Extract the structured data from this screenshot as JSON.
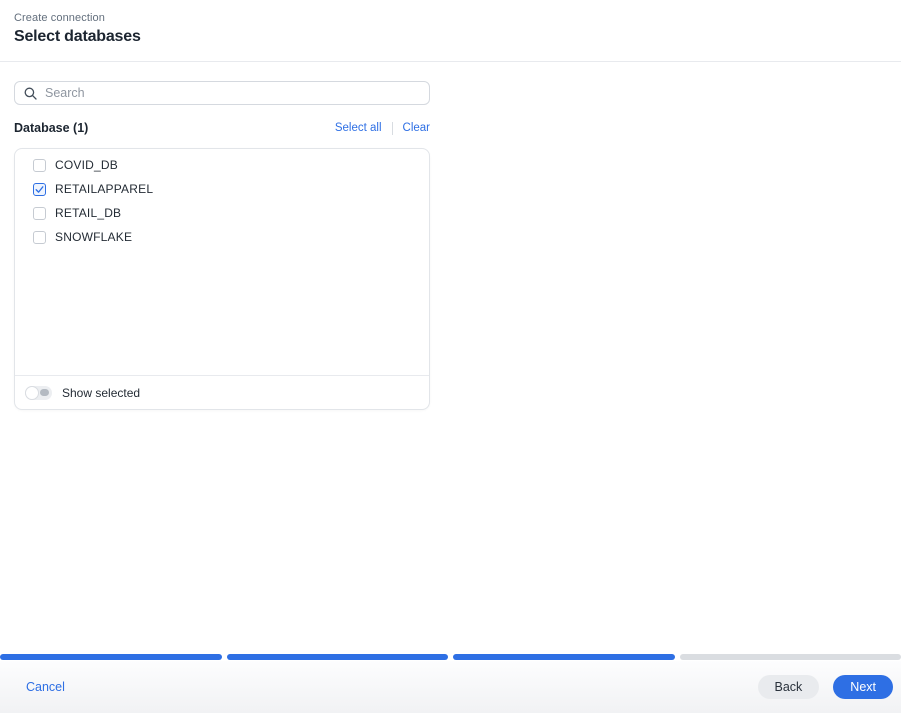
{
  "header": {
    "breadcrumb": "Create connection",
    "title": "Select databases"
  },
  "search": {
    "placeholder": "Search",
    "value": ""
  },
  "list_header": {
    "label": "Database (1)",
    "select_all_label": "Select all",
    "clear_label": "Clear"
  },
  "databases": [
    {
      "name": "COVID_DB",
      "checked": false
    },
    {
      "name": "RETAILAPPAREL",
      "checked": true
    },
    {
      "name": "RETAIL_DB",
      "checked": false
    },
    {
      "name": "SNOWFLAKE",
      "checked": false
    }
  ],
  "show_selected": {
    "label": "Show selected",
    "enabled": false
  },
  "progress": {
    "total_steps": 4,
    "completed_steps": 3
  },
  "footer": {
    "cancel_label": "Cancel",
    "back_label": "Back",
    "next_label": "Next"
  },
  "icons": {
    "search": "magnifying-glass",
    "checkbox_check": "checkmark"
  },
  "colors": {
    "accent_blue": "#2e6fe4",
    "progress_inactive": "#dadde1",
    "title_text": "#1c2530",
    "muted_text": "#636f7d",
    "border": "#e2e5e9"
  }
}
